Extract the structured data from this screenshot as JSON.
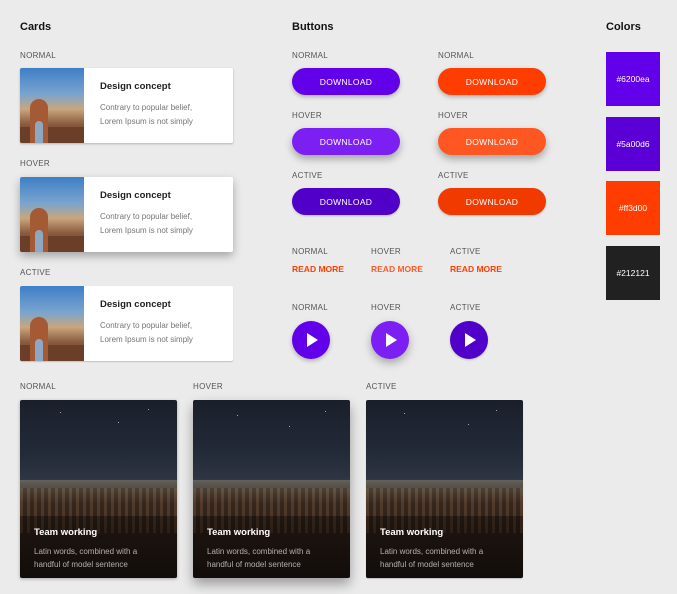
{
  "sections": {
    "cards": "Cards",
    "buttons": "Buttons",
    "colors": "Colors"
  },
  "states": {
    "normal": "NORMAL",
    "hover": "HOVER",
    "active": "ACTIVE"
  },
  "horizontal_card": {
    "title": "Design concept",
    "line1": "Contrary to popular belief,",
    "line2": "Lorem Ipsum is not simply"
  },
  "buttons": {
    "download": "DOWNLOAD",
    "read_more": "READ MORE",
    "play_icon": "play-icon"
  },
  "colors": {
    "purple": "#6200ea",
    "purple_dark": "#5a00d6",
    "orange": "#ff3d00",
    "dark": "#212121"
  },
  "swatches": [
    "#6200ea",
    "#5a00d6",
    "#ff3d00",
    "#212121"
  ],
  "image_card": {
    "title": "Team working",
    "line1": "Latin words, combined with a",
    "line2": "handful of model sentence"
  }
}
